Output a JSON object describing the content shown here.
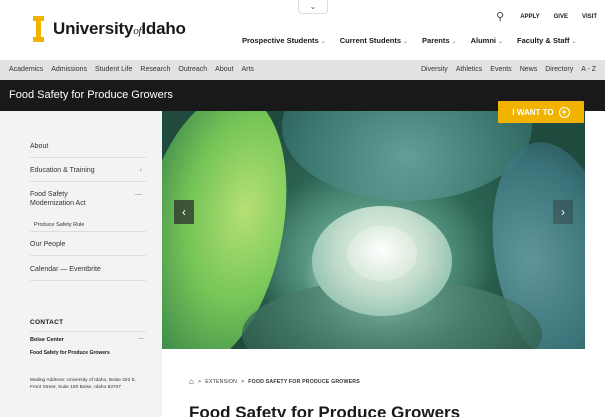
{
  "header": {
    "logo_name_1": "University",
    "logo_of": "of",
    "logo_name_2": "Idaho",
    "top_tab_icon": "chevron-down-icon",
    "top_tab_glyph": "⌄",
    "utility": {
      "search_icon": "search-icon",
      "search_glyph": "⚲",
      "apply": "APPLY",
      "give": "GIVE",
      "visit": "VISIT"
    },
    "main_nav": [
      {
        "label": "Prospective Students",
        "chevron": "⌄"
      },
      {
        "label": "Current Students",
        "chevron": "⌄"
      },
      {
        "label": "Parents",
        "chevron": "⌄"
      },
      {
        "label": "Alumni",
        "chevron": "⌄"
      },
      {
        "label": "Faculty & Staff",
        "chevron": "⌄"
      }
    ]
  },
  "linkbar": {
    "left": [
      "Academics",
      "Admissions",
      "Student Life",
      "Research",
      "Outreach",
      "About",
      "Arts"
    ],
    "right": [
      "Diversity",
      "Athletics",
      "Events",
      "News",
      "Directory",
      "A - Z"
    ]
  },
  "titlebar": {
    "title": "Food Safety for Produce Growers",
    "i_want_to": "I WANT TO",
    "plus_glyph": "+"
  },
  "sidebar": {
    "items": [
      {
        "label": "About"
      },
      {
        "label": "Education & Training",
        "chevron": "‹"
      },
      {
        "label": "Food Safety Modernization Act",
        "chevron": "—"
      },
      {
        "label": "Our People"
      },
      {
        "label": "Calendar — Eventbrite"
      }
    ],
    "sub_item": "Produce Safety Rule",
    "contact": {
      "label": "CONTACT",
      "center": "Boise Center",
      "center_chevron": "—",
      "org": "Food Safety for Produce Growers",
      "address": "Mailing Address: University of Idaho, Boise 322 E. Front Street, Suite 190 Boise, Idaho 83707"
    }
  },
  "hero": {
    "prev_glyph": "‹",
    "next_glyph": "›"
  },
  "breadcrumb": {
    "home_icon": "home-icon",
    "home_glyph": "⌂",
    "sep": ">",
    "items": [
      "EXTENSION",
      "FOOD SAFETY FOR PRODUCE GROWERS"
    ]
  },
  "page_title": "Food Safety for Produce Growers",
  "colors": {
    "gold": "#f1b300",
    "black": "#191919",
    "linkbar": "#e2e2e0",
    "sidebar": "#f3f3f3"
  }
}
